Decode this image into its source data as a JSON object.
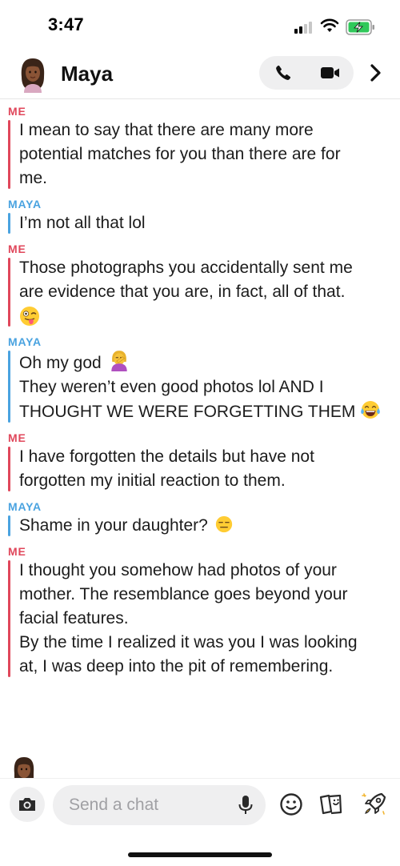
{
  "status_bar": {
    "time": "3:47"
  },
  "header": {
    "contact_name": "Maya"
  },
  "messages": [
    {
      "sender": "ME",
      "lines": [
        "I mean to say that there are many more",
        "potential matches for you than there are for",
        "me."
      ]
    },
    {
      "sender": "MAYA",
      "lines": [
        "I’m not all that lol"
      ]
    },
    {
      "sender": "ME",
      "lines": [
        "Those photographs you accidentally sent me",
        "are evidence that you are, in fact, all of that."
      ]
    },
    {
      "sender": "MAYA",
      "lines": [
        "Oh my god",
        "They weren’t even good photos lol AND I",
        "THOUGHT WE WERE FORGETTING THEM"
      ]
    },
    {
      "sender": "ME",
      "lines": [
        "I have forgotten the details but have not",
        "forgotten my initial reaction to them."
      ]
    },
    {
      "sender": "MAYA",
      "lines": [
        "Shame in your daughter?"
      ]
    },
    {
      "sender": "ME",
      "lines": [
        "I thought you somehow had photos of your",
        "mother. The resemblance goes beyond your",
        "facial features.",
        "By the time I realized it was you I was looking",
        "at, I was deep into the pit of remembering."
      ]
    }
  ],
  "chat_bar": {
    "placeholder": "Send a chat"
  },
  "colors": {
    "me": "#e0475b",
    "maya": "#4aa3e0"
  }
}
